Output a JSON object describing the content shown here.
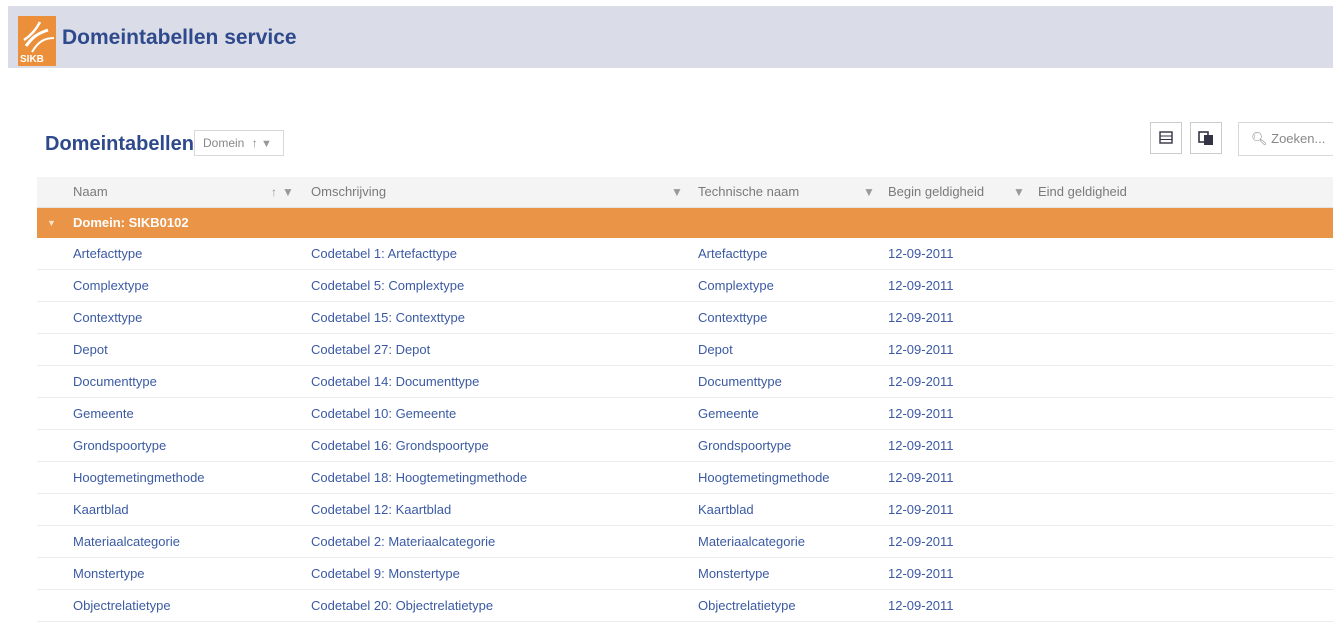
{
  "app": {
    "title": "Domeintabellen service",
    "logo_text": "SIKB"
  },
  "section": {
    "title": "Domeintabellen",
    "group_chip": "Domein"
  },
  "search": {
    "placeholder": "Zoeken..."
  },
  "columns": [
    "Naam",
    "Omschrijving",
    "Technische naam",
    "Begin geldigheid",
    "Eind geldigheid"
  ],
  "group": {
    "label": "Domein: SIKB0102"
  },
  "rows": [
    [
      "Artefacttype",
      "Codetabel 1: Artefacttype",
      "Artefacttype",
      "12-09-2011",
      ""
    ],
    [
      "Complextype",
      "Codetabel 5: Complextype",
      "Complextype",
      "12-09-2011",
      ""
    ],
    [
      "Contexttype",
      "Codetabel 15: Contexttype",
      "Contexttype",
      "12-09-2011",
      ""
    ],
    [
      "Depot",
      "Codetabel 27: Depot",
      "Depot",
      "12-09-2011",
      ""
    ],
    [
      "Documenttype",
      "Codetabel 14: Documenttype",
      "Documenttype",
      "12-09-2011",
      ""
    ],
    [
      "Gemeente",
      "Codetabel 10: Gemeente",
      "Gemeente",
      "12-09-2011",
      ""
    ],
    [
      "Grondspoortype",
      "Codetabel 16: Grondspoortype",
      "Grondspoortype",
      "12-09-2011",
      ""
    ],
    [
      "Hoogtemetingmethode",
      "Codetabel 18: Hoogtemetingmethode",
      "Hoogtemetingmethode",
      "12-09-2011",
      ""
    ],
    [
      "Kaartblad",
      "Codetabel 12: Kaartblad",
      "Kaartblad",
      "12-09-2011",
      ""
    ],
    [
      "Materiaalcategorie",
      "Codetabel 2: Materiaalcategorie",
      "Materiaalcategorie",
      "12-09-2011",
      ""
    ],
    [
      "Monstertype",
      "Codetabel 9: Monstertype",
      "Monstertype",
      "12-09-2011",
      ""
    ],
    [
      "Objectrelatietype",
      "Codetabel 20: Objectrelatietype",
      "Objectrelatietype",
      "12-09-2011",
      ""
    ]
  ],
  "colors": {
    "accent": "#ea9448",
    "header_bg": "#dadde8",
    "link": "#3b5aa3"
  }
}
